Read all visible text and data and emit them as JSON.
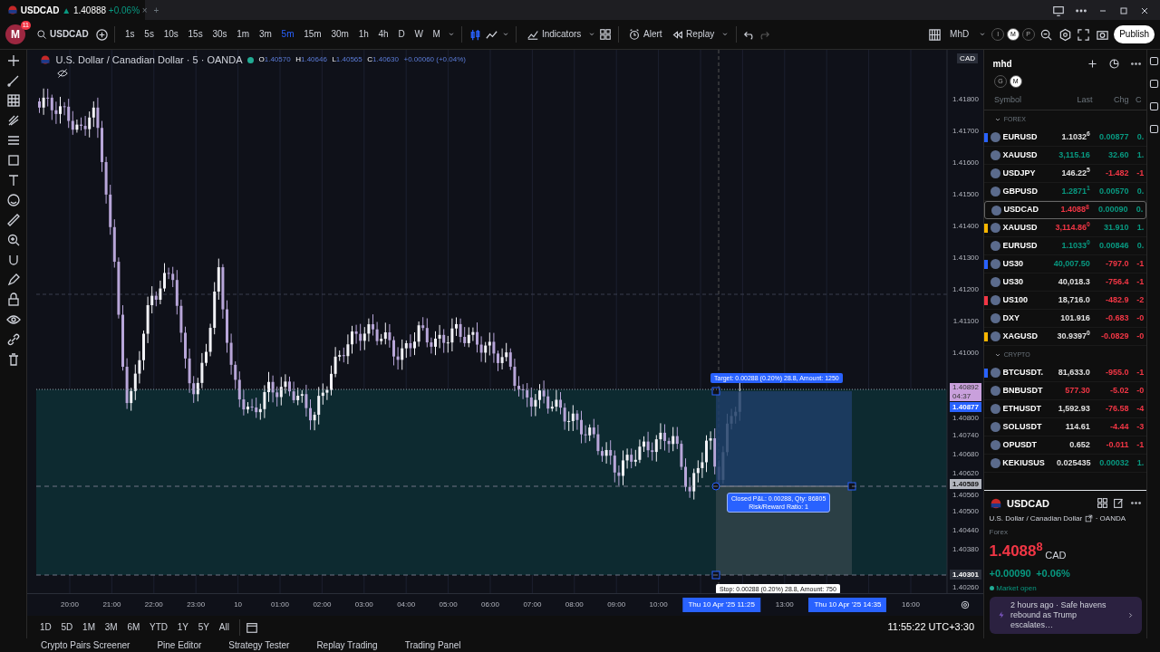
{
  "tab": {
    "title": "USDCAD",
    "arrow": "▲",
    "price": "1.40888",
    "change": "+0.06%",
    "close": "×",
    "add": "+"
  },
  "toolbar": {
    "avatar": "M",
    "badge": "11",
    "symbol": "USDCAD",
    "intervals": [
      {
        "label": "1s",
        "selected": false
      },
      {
        "label": "5s",
        "selected": false
      },
      {
        "label": "10s",
        "selected": false
      },
      {
        "label": "15s",
        "selected": false
      },
      {
        "label": "30s",
        "selected": false
      },
      {
        "label": "1m",
        "selected": false
      },
      {
        "label": "3m",
        "selected": false
      },
      {
        "label": "5m",
        "selected": true
      },
      {
        "label": "15m",
        "selected": false
      },
      {
        "label": "30m",
        "selected": false
      },
      {
        "label": "1h",
        "selected": false
      },
      {
        "label": "4h",
        "selected": false
      },
      {
        "label": "D",
        "selected": false
      },
      {
        "label": "W",
        "selected": false
      },
      {
        "label": "M",
        "selected": false
      }
    ],
    "indicators": "Indicators",
    "alert": "Alert",
    "replay": "Replay",
    "layout": "MhD",
    "modes": [
      {
        "label": "I",
        "selected": false
      },
      {
        "label": "M",
        "selected": true
      },
      {
        "label": "P",
        "selected": false
      }
    ],
    "publish": "Publish"
  },
  "chart": {
    "title": "U.S. Dollar / Canadian Dollar · 5 · OANDA",
    "ohlc": [
      {
        "key": "O",
        "value": "1.40570"
      },
      {
        "key": "H",
        "value": "1.40646"
      },
      {
        "key": "L",
        "value": "1.40565"
      },
      {
        "key": "C",
        "value": "1.40630"
      }
    ],
    "change": "+0.00060 (+0.04%)",
    "currency": "CAD",
    "price_axis": [
      {
        "label": "1.41800",
        "kind": "tick"
      },
      {
        "label": "1.41700",
        "kind": "tick"
      },
      {
        "label": "1.41600",
        "kind": "tick"
      },
      {
        "label": "1.41500",
        "kind": "tick"
      },
      {
        "label": "1.41400",
        "kind": "tick"
      },
      {
        "label": "1.41300",
        "kind": "tick"
      },
      {
        "label": "1.41200",
        "kind": "tick"
      },
      {
        "label": "1.41100",
        "kind": "tick"
      },
      {
        "label": "1.41000",
        "kind": "tick"
      },
      {
        "label": "1.40892",
        "sub": "04:37",
        "kind": "countdown"
      },
      {
        "label": "1.40877",
        "kind": "last"
      },
      {
        "label": "1.40800",
        "kind": "tick"
      },
      {
        "label": "1.40740",
        "kind": "tick"
      },
      {
        "label": "1.40680",
        "kind": "tick"
      },
      {
        "label": "1.40620",
        "kind": "tick"
      },
      {
        "label": "1.40589",
        "kind": "crosshair"
      },
      {
        "label": "1.40560",
        "kind": "tick"
      },
      {
        "label": "1.40500",
        "kind": "tick"
      },
      {
        "label": "1.40440",
        "kind": "tick"
      },
      {
        "label": "1.40380",
        "kind": "tick"
      },
      {
        "label": "1.40301",
        "kind": "stop"
      },
      {
        "label": "1.40260",
        "kind": "tick"
      }
    ],
    "time_axis": [
      {
        "label": "20:00",
        "kind": "tick"
      },
      {
        "label": "21:00",
        "kind": "tick"
      },
      {
        "label": "22:00",
        "kind": "tick"
      },
      {
        "label": "23:00",
        "kind": "tick"
      },
      {
        "label": "10",
        "kind": "tick"
      },
      {
        "label": "01:00",
        "kind": "tick"
      },
      {
        "label": "02:00",
        "kind": "tick"
      },
      {
        "label": "03:00",
        "kind": "tick"
      },
      {
        "label": "04:00",
        "kind": "tick"
      },
      {
        "label": "05:00",
        "kind": "tick"
      },
      {
        "label": "06:00",
        "kind": "tick"
      },
      {
        "label": "07:00",
        "kind": "tick"
      },
      {
        "label": "08:00",
        "kind": "tick"
      },
      {
        "label": "09:00",
        "kind": "tick"
      },
      {
        "label": "10:00",
        "kind": "tick"
      },
      {
        "label": "Thu 10 Apr '25",
        "sub": "11:25",
        "kind": "marker"
      },
      {
        "label": "13:00",
        "kind": "tick"
      },
      {
        "label": "Thu 10 Apr '25",
        "sub": "14:35",
        "kind": "marker"
      },
      {
        "label": "16:00",
        "kind": "tick"
      }
    ],
    "position": {
      "target": "Target: 0.00288 (0.20%) 28.8, Amount: 1250",
      "result": "Closed P&L: 0.00288, Qty: 86805",
      "ratio": "Risk/Reward Ratio: 1",
      "stop": "Stop: 0.00288 (0.20%) 28.8, Amount: 750"
    }
  },
  "ranges": [
    {
      "label": "1D"
    },
    {
      "label": "5D"
    },
    {
      "label": "1M"
    },
    {
      "label": "3M"
    },
    {
      "label": "6M"
    },
    {
      "label": "YTD"
    },
    {
      "label": "1Y"
    },
    {
      "label": "5Y"
    },
    {
      "label": "All"
    }
  ],
  "clock": "11:55:22 UTC+3:30",
  "bottom_tabs": [
    "Crypto Pairs Screener",
    "Pine Editor",
    "Strategy Tester",
    "Replay Trading",
    "Trading Panel"
  ],
  "watchlist": {
    "name": "mhd",
    "groups": [
      {
        "label": "G",
        "selected": false
      },
      {
        "label": "M",
        "selected": true
      }
    ],
    "columns": [
      "Symbol",
      "Last",
      "Chg",
      "C"
    ],
    "sections": [
      {
        "title": "FOREX",
        "expanded": true,
        "rows": [
          {
            "flag": {
              "color": "#2962ff"
            },
            "symbol": "EURUSD",
            "last": "1.1032$^{6}$",
            "color": "#e0e0e0",
            "chg": "0.00877",
            "pct": "0.",
            "chg_up": true,
            "selected": false
          },
          {
            "symbol": "XAUUSD",
            "last": "3,115.16",
            "color": "#089981",
            "chg": "32.60",
            "pct": "1.",
            "chg_up": true,
            "selected": false
          },
          {
            "symbol": "USDJPY",
            "last": "146.22$^{5}$",
            "color": "#e0e0e0",
            "chg": "-1.482",
            "pct": "-1",
            "chg_up": false,
            "selected": false
          },
          {
            "symbol": "GBPUSD",
            "last": "1.2871$^{1}$",
            "color": "#089981",
            "chg": "0.00570",
            "pct": "0.",
            "chg_up": true,
            "selected": false
          },
          {
            "symbol": "USDCAD",
            "last": "1.4088$^{8}$",
            "color": "#f23645",
            "chg": "0.00090",
            "pct": "0.",
            "chg_up": true,
            "selected": true
          },
          {
            "flag": {
              "color": "#f7b500"
            },
            "symbol": "XAUUSD",
            "last": "3,114.86$^{0}$",
            "color": "#f23645",
            "chg": "31.910",
            "pct": "1.",
            "chg_up": true,
            "selected": false
          },
          {
            "symbol": "EURUSD",
            "last": "1.1033$^{0}$",
            "color": "#089981",
            "chg": "0.00846",
            "pct": "0.",
            "chg_up": true,
            "selected": false
          },
          {
            "flag": {
              "color": "#2962ff"
            },
            "symbol": "US30",
            "last": "40,007.50",
            "color": "#089981",
            "chg": "-797.0",
            "pct": "-1",
            "chg_up": false,
            "selected": false
          },
          {
            "symbol": "US30",
            "last": "40,018.3",
            "color": "#e0e0e0",
            "chg": "-756.4",
            "pct": "-1",
            "chg_up": false,
            "selected": false
          },
          {
            "flag": {
              "color": "#f23645"
            },
            "symbol": "US100",
            "last": "18,716.0",
            "color": "#e0e0e0",
            "chg": "-482.9",
            "pct": "-2",
            "chg_up": false,
            "selected": false
          },
          {
            "symbol": "DXY",
            "last": "101.916",
            "color": "#e0e0e0",
            "chg": "-0.683",
            "pct": "-0",
            "chg_up": false,
            "selected": false
          },
          {
            "flag": {
              "color": "#f7b500"
            },
            "symbol": "XAGUSD",
            "last": "30.9397$^{0}$",
            "color": "#e0e0e0",
            "chg": "-0.0829",
            "pct": "-0",
            "chg_up": false,
            "selected": false
          }
        ]
      },
      {
        "title": "CRYPTO",
        "expanded": true,
        "rows": [
          {
            "flag": {
              "color": "#2962ff"
            },
            "symbol": "BTCUSDT.",
            "last": "81,633.0",
            "color": "#e0e0e0",
            "chg": "-955.0",
            "pct": "-1",
            "chg_up": false,
            "selected": false
          },
          {
            "symbol": "BNBUSDT",
            "last": "577.30",
            "color": "#f23645",
            "chg": "-5.02",
            "pct": "-0",
            "chg_up": false,
            "selected": false
          },
          {
            "symbol": "ETHUSDT",
            "last": "1,592.93",
            "color": "#e0e0e0",
            "chg": "-76.58",
            "pct": "-4",
            "chg_up": false,
            "selected": false
          },
          {
            "symbol": "SOLUSDT",
            "last": "114.61",
            "color": "#e0e0e0",
            "chg": "-4.44",
            "pct": "-3",
            "chg_up": false,
            "selected": false
          },
          {
            "symbol": "OPUSDT",
            "last": "0.652",
            "color": "#e0e0e0",
            "chg": "-0.011",
            "pct": "-1",
            "chg_up": false,
            "selected": false
          },
          {
            "symbol": "KEKIUSUS",
            "last": "0.025435",
            "color": "#e0e0e0",
            "chg": "0.00032",
            "pct": "1.",
            "chg_up": true,
            "selected": false
          }
        ]
      }
    ]
  },
  "details": {
    "symbol": "USDCAD",
    "name": "U.S. Dollar / Canadian Dollar",
    "exchange": "· OANDA",
    "type": "Forex",
    "price": "1.4088$^{8}$",
    "currency": "CAD",
    "change": "+0.00090",
    "change_pct": "+0.06%",
    "status": "Market open",
    "news": "2 hours ago · Safe havens rebound as Trump escalates…"
  }
}
